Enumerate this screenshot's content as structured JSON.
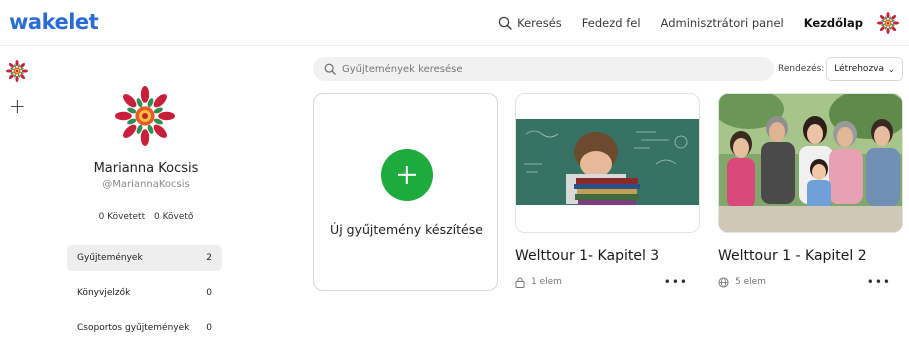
{
  "app": {
    "logo": "wakelet"
  },
  "nav": {
    "items": [
      {
        "label": "Keresés",
        "icon": "search-icon",
        "active": false
      },
      {
        "label": "Fedezd fel",
        "active": false
      },
      {
        "label": "Adminisztrátori panel",
        "active": false
      },
      {
        "label": "Kezdőlap",
        "active": true
      }
    ]
  },
  "rail": {
    "add_icon": "plus-icon"
  },
  "profile": {
    "name": "Marianna Kocsis",
    "handle": "@MariannaKocsis",
    "following": "0 Követett",
    "followers": "0 Követő"
  },
  "side_menu": [
    {
      "label": "Gyűjtemények",
      "count": "2",
      "active": true
    },
    {
      "label": "Könyvjelzők",
      "count": "0",
      "active": false
    },
    {
      "label": "Csoportos gyűjtemények",
      "count": "0",
      "active": false
    }
  ],
  "search": {
    "placeholder": "Gyűjtemények keresése"
  },
  "sort": {
    "label": "Rendezés:",
    "value": "Létrehozva"
  },
  "new_collection": {
    "label": "Új gyűjtemény készítése"
  },
  "collections": [
    {
      "title": "Welttour 1- Kapitel 3",
      "meta": "1 elem",
      "visibility_icon": "lock-icon"
    },
    {
      "title": "Welttour 1 - Kapitel 2",
      "meta": "5 elem",
      "visibility_icon": "globe-icon"
    }
  ],
  "colors": {
    "accent_green": "#1faa3d",
    "logo_blue": "#2a6bd4",
    "avatar_red": "#c8203a"
  }
}
